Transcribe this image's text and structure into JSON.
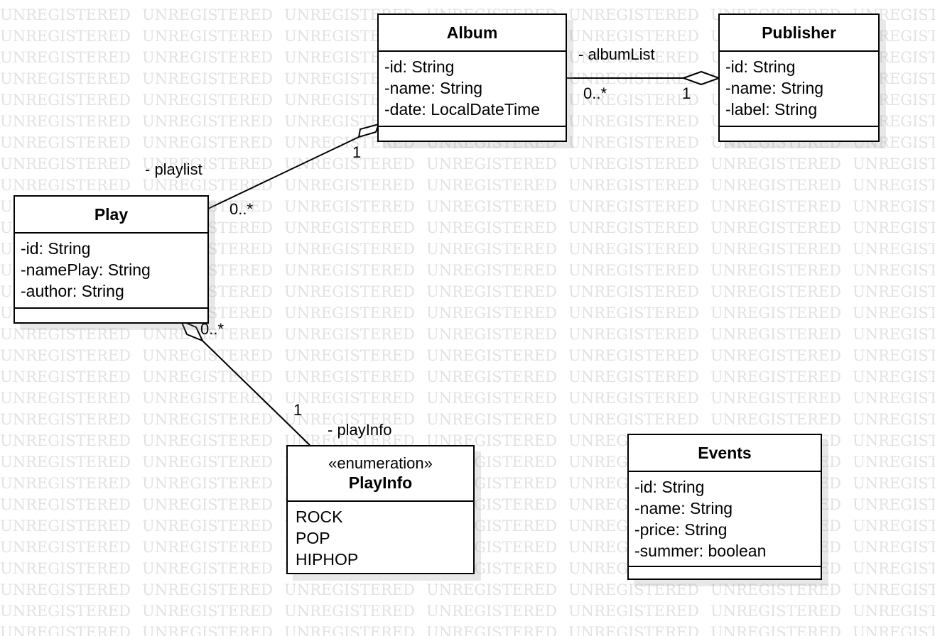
{
  "watermark": {
    "text": "UNREGISTERED"
  },
  "classes": {
    "album": {
      "name": "Album",
      "attributes": [
        "-id: String",
        "-name: String",
        "-date: LocalDateTime"
      ]
    },
    "publisher": {
      "name": "Publisher",
      "attributes": [
        "-id: String",
        "-name: String",
        "-label: String"
      ]
    },
    "play": {
      "name": "Play",
      "attributes": [
        "-id: String",
        "-namePlay: String",
        "-author: String"
      ]
    },
    "playinfo": {
      "stereotype": "«enumeration»",
      "name": "PlayInfo",
      "literals": [
        "ROCK",
        "POP",
        "HIPHOP"
      ]
    },
    "events": {
      "name": "Events",
      "attributes": [
        "-id: String",
        "-name: String",
        "-price: String",
        "-summer: boolean"
      ]
    }
  },
  "associations": {
    "album_publisher": {
      "role": "- albumList",
      "album_end_multiplicity": "0..*",
      "publisher_end_multiplicity": "1"
    },
    "play_album": {
      "role": "- playlist",
      "album_end_multiplicity": "1",
      "play_end_multiplicity": "0..*"
    },
    "play_playinfo": {
      "role": "- playInfo",
      "play_end_multiplicity": "0..*",
      "playinfo_end_multiplicity": "1"
    }
  }
}
